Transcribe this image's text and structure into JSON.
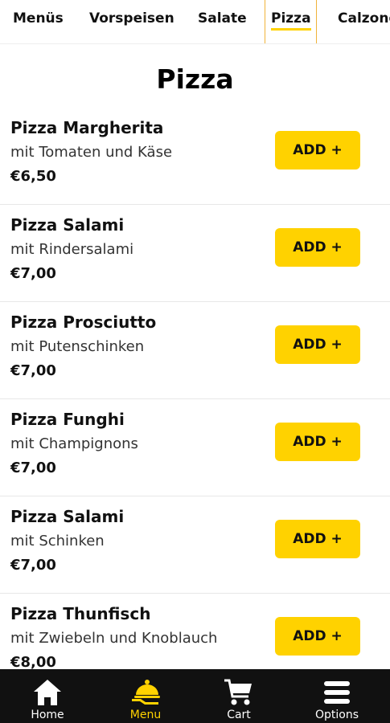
{
  "category_tabs": [
    {
      "label": "Menüs"
    },
    {
      "label": "Vorspeisen"
    },
    {
      "label": "Salate"
    },
    {
      "label": "Pizza"
    },
    {
      "label": "Calzone"
    }
  ],
  "active_tab": "Pizza",
  "section_title": "Pizza",
  "items": [
    {
      "name": "Pizza Margherita",
      "description": "mit Tomaten und Käse",
      "price": "€6,50",
      "button": "ADD +"
    },
    {
      "name": "Pizza Salami",
      "description": "mit Rindersalami",
      "price": "€7,00",
      "button": "ADD +"
    },
    {
      "name": "Pizza Prosciutto",
      "description": "mit Putenschinken",
      "price": "€7,00",
      "button": "ADD +"
    },
    {
      "name": "Pizza Funghi",
      "description": "mit Champignons",
      "price": "€7,00",
      "button": "ADD +"
    },
    {
      "name": "Pizza Salami",
      "description": "mit Schinken",
      "price": "€7,00",
      "button": "ADD +"
    },
    {
      "name": "Pizza Thunfisch",
      "description": "mit Zwiebeln und Knoblauch",
      "price": "€8,00",
      "button": "ADD +"
    }
  ],
  "bottom_nav": [
    {
      "label": "Home",
      "icon": "home-icon"
    },
    {
      "label": "Menu",
      "icon": "menu-cloche-icon",
      "active": true
    },
    {
      "label": "Cart",
      "icon": "cart-icon"
    },
    {
      "label": "Options",
      "icon": "options-hamburger-icon"
    }
  ],
  "colors": {
    "accent": "#ffd200",
    "nav_bg": "#111111",
    "tab_border": "#f0b33a"
  }
}
